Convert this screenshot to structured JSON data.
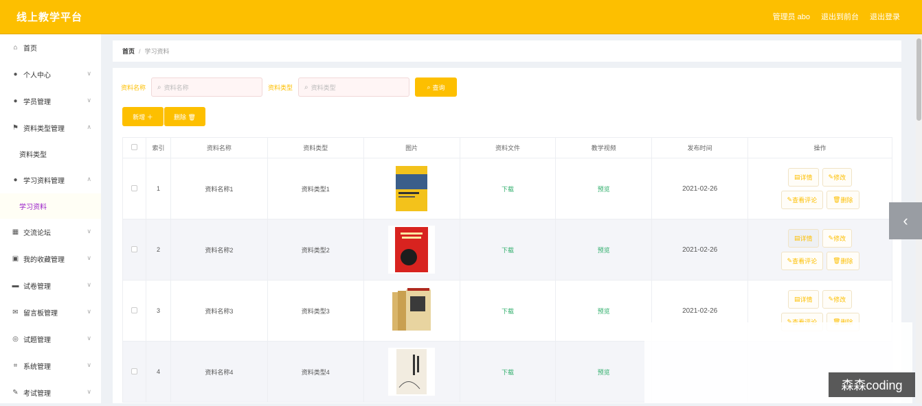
{
  "header": {
    "brand": "线上教学平台",
    "admin": "管理员 abo",
    "front": "退出到前台",
    "logout": "退出登录"
  },
  "sidebar": {
    "items": [
      {
        "label": "首页",
        "icon": "home-icon",
        "chev": ""
      },
      {
        "label": "个人中心",
        "icon": "user-icon",
        "chev": "∨"
      },
      {
        "label": "学员管理",
        "icon": "pin-icon",
        "chev": "∨"
      },
      {
        "label": "资料类型管理",
        "icon": "flag-icon",
        "chev": "∧"
      },
      {
        "label": "资料类型",
        "sub": true
      },
      {
        "label": "学习资料管理",
        "icon": "user-icon",
        "chev": "∧"
      },
      {
        "label": "学习资料",
        "sub": true,
        "active": true
      },
      {
        "label": "交流论坛",
        "icon": "grid-icon",
        "chev": "∨"
      },
      {
        "label": "我的收藏管理",
        "icon": "chart-icon",
        "chev": "∨"
      },
      {
        "label": "试卷管理",
        "icon": "inbox-icon",
        "chev": "∨"
      },
      {
        "label": "留言板管理",
        "icon": "mail-icon",
        "chev": "∨"
      },
      {
        "label": "试题管理",
        "icon": "globe-icon",
        "chev": "∨"
      },
      {
        "label": "系统管理",
        "icon": "crop-icon",
        "chev": "∨"
      },
      {
        "label": "考试管理",
        "icon": "edit-icon",
        "chev": "∨"
      }
    ]
  },
  "breadcrumb": {
    "home": "首页",
    "sep": "/",
    "current": "学习资料"
  },
  "search": {
    "name_label": "资料名称",
    "name_placeholder": "资料名称",
    "type_label": "资料类型",
    "type_placeholder": "资料类型",
    "query": "查询"
  },
  "actions": {
    "add": "新增 ＋",
    "delete": "删除 🗑"
  },
  "table": {
    "headers": [
      "",
      "索引",
      "资料名称",
      "资料类型",
      "图片",
      "资料文件",
      "教学视频",
      "发布时间",
      "操作"
    ],
    "rows": [
      {
        "index": "1",
        "name": "资料名称1",
        "type": "资料类型1",
        "file": "下载",
        "video": "预览",
        "date": "2021-02-26"
      },
      {
        "index": "2",
        "name": "资料名称2",
        "type": "资料类型2",
        "file": "下载",
        "video": "预览",
        "date": "2021-02-26"
      },
      {
        "index": "3",
        "name": "资料名称3",
        "type": "资料类型3",
        "file": "下载",
        "video": "预览",
        "date": "2021-02-26"
      },
      {
        "index": "4",
        "name": "资料名称4",
        "type": "资料类型4",
        "file": "下载",
        "video": "预览",
        "date": ""
      }
    ],
    "ops": {
      "detail": "详情",
      "edit": "修改",
      "comments": "查看评论",
      "delete": "删除"
    }
  },
  "watermark": "森森coding",
  "colors": {
    "accent": "#fdbf00",
    "active_sub": "#9b21c9",
    "green": "#2fae6b"
  }
}
